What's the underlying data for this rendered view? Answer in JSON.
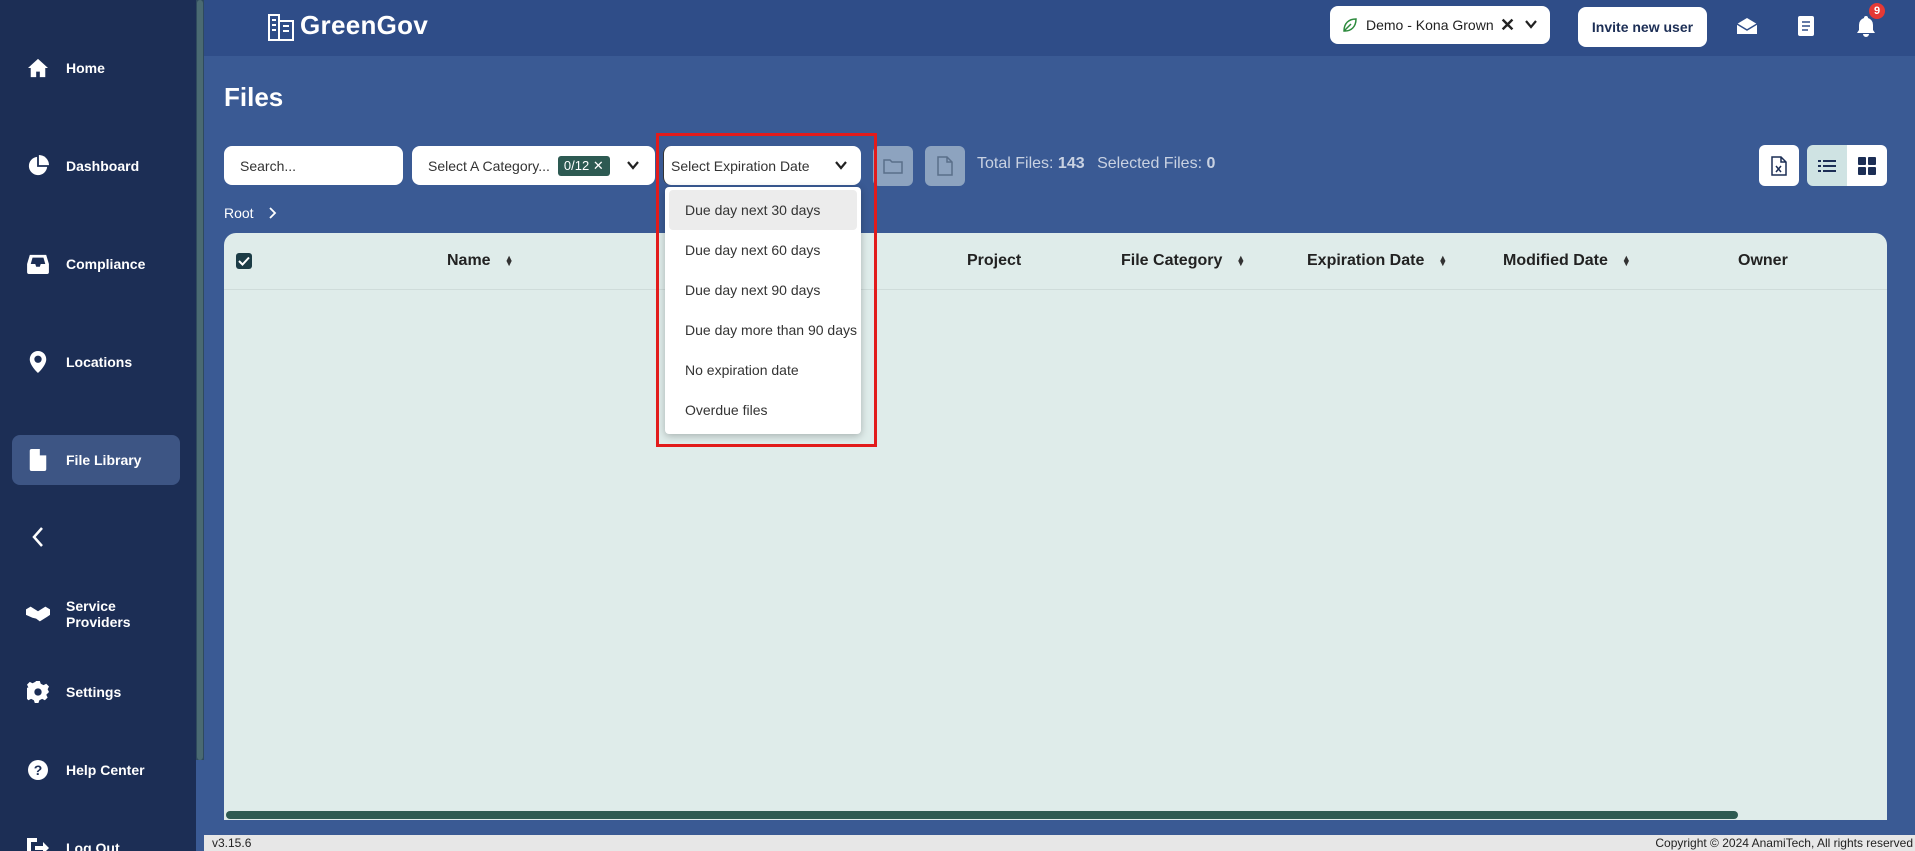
{
  "app": {
    "logo_text": "GreenGov",
    "version": "v3.15.6",
    "copyright": "Copyright © 2024 AnamiTech, All rights reserved"
  },
  "sidebar": {
    "items": [
      {
        "label": "Home",
        "icon": "home-icon"
      },
      {
        "label": "Dashboard",
        "icon": "pie-chart-icon"
      },
      {
        "label": "Compliance",
        "icon": "inbox-icon"
      },
      {
        "label": "Locations",
        "icon": "map-pin-icon"
      },
      {
        "label": "File Library",
        "icon": "file-icon",
        "active": true
      },
      {
        "label": "Service Providers",
        "icon": "handshake-icon"
      },
      {
        "label": "Settings",
        "icon": "gear-icon"
      },
      {
        "label": "Help Center",
        "icon": "help-icon"
      },
      {
        "label": "Log Out",
        "icon": "logout-icon"
      }
    ]
  },
  "header": {
    "org_selector": "Demo - Kona Grown",
    "invite_label": "Invite new user",
    "notification_count": "9"
  },
  "main": {
    "title": "Files",
    "search_placeholder": "Search...",
    "category_placeholder": "Select A Category...",
    "category_count": "0/12",
    "expiration_placeholder": "Select Expiration Date",
    "total_files_label": "Total Files:",
    "total_files": "143",
    "selected_files_label": "Selected Files:",
    "selected_files": "0",
    "breadcrumb_root": "Root"
  },
  "table": {
    "columns": [
      "Name",
      "Project",
      "File Category",
      "Expiration Date",
      "Modified Date",
      "Owner"
    ]
  },
  "expiration_dropdown": {
    "options": [
      "Due day next 30 days",
      "Due day next 60 days",
      "Due day next 90 days",
      "Due day more than 90 days",
      "No expiration date",
      "Overdue files"
    ]
  },
  "colors": {
    "sidebar_bg": "#1c2e55",
    "main_bg": "#3a5a94",
    "table_bg": "#dfecea",
    "accent": "#2d5a52",
    "highlight": "#e21b1b"
  }
}
